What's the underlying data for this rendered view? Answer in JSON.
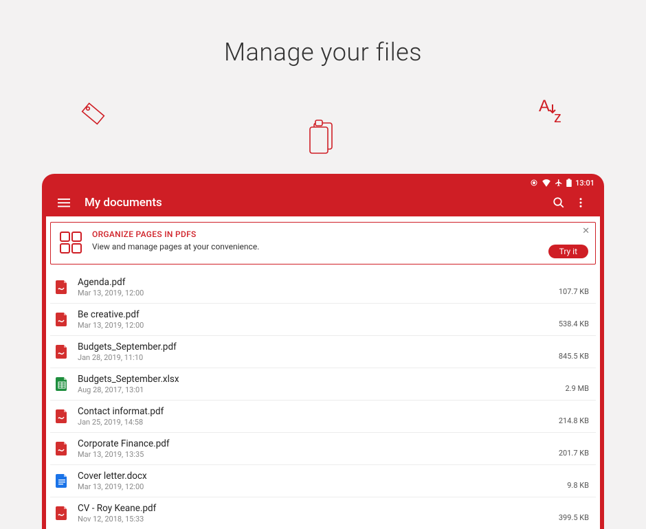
{
  "hero": {
    "title": "Manage your files"
  },
  "status": {
    "time": "13:01"
  },
  "appbar": {
    "title": "My documents"
  },
  "banner": {
    "title": "ORGANIZE PAGES IN PDFS",
    "subtitle": "View and manage pages at your convenience.",
    "cta": "Try it"
  },
  "files": [
    {
      "name": "Agenda.pdf",
      "date": "Mar 13, 2019, 12:00",
      "size": "107.7 KB",
      "type": "pdf"
    },
    {
      "name": "Be creative.pdf",
      "date": "Mar 13, 2019, 12:00",
      "size": "538.4 KB",
      "type": "pdf"
    },
    {
      "name": "Budgets_September.pdf",
      "date": "Jan 28, 2019, 11:10",
      "size": "845.5 KB",
      "type": "pdf"
    },
    {
      "name": "Budgets_September.xlsx",
      "date": "Aug 28, 2017, 13:01",
      "size": "2.9 MB",
      "type": "xls"
    },
    {
      "name": "Contact informat.pdf",
      "date": "Jan 25, 2019, 14:58",
      "size": "214.8 KB",
      "type": "pdf"
    },
    {
      "name": "Corporate Finance.pdf",
      "date": "Mar 13, 2019, 13:35",
      "size": "201.7 KB",
      "type": "pdf"
    },
    {
      "name": "Cover letter.docx",
      "date": "Mar 13, 2019, 12:00",
      "size": "9.8 KB",
      "type": "doc"
    },
    {
      "name": "CV - Roy Keane.pdf",
      "date": "Nov 12, 2018, 15:33",
      "size": "399.5 KB",
      "type": "pdf"
    }
  ]
}
